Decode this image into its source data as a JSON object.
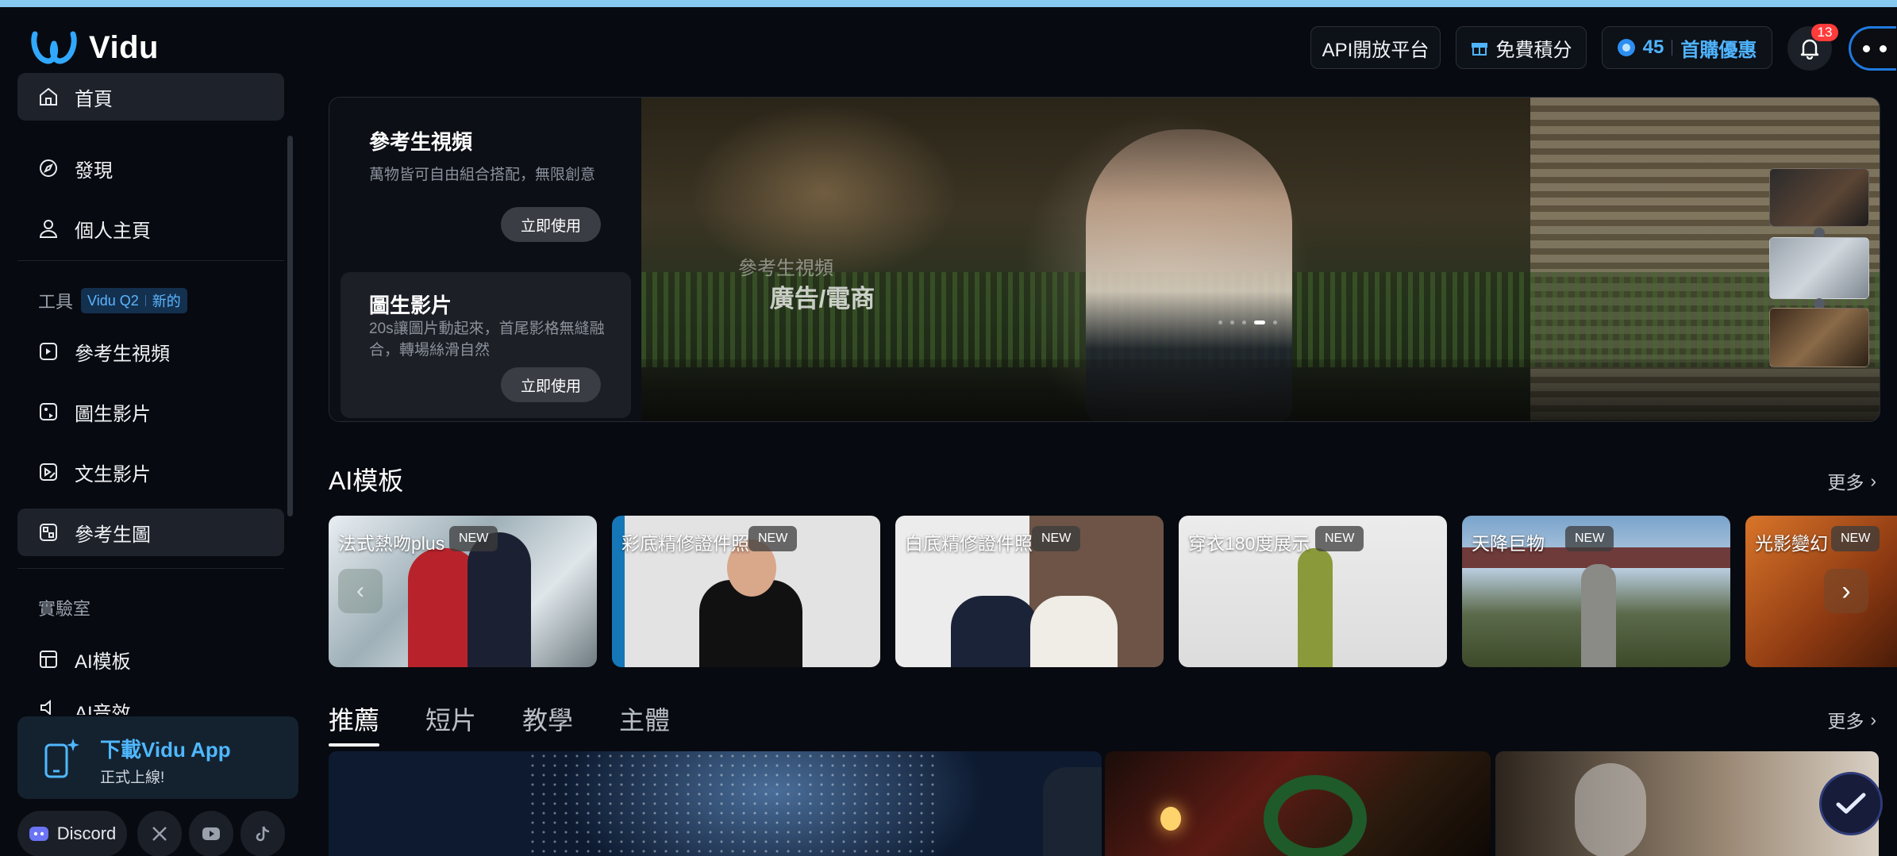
{
  "header": {
    "logo_text": "Vidu",
    "api_label": "API開放平台",
    "free_credits_label": "免費積分",
    "credits_count": "45",
    "buy_label": "首購優惠",
    "notification_count": "13"
  },
  "sidebar": {
    "nav": [
      {
        "label": "首頁",
        "icon": "home-icon"
      },
      {
        "label": "發現",
        "icon": "compass-icon"
      },
      {
        "label": "個人主頁",
        "icon": "user-icon"
      }
    ],
    "tools_section": {
      "label": "工具",
      "tag_model": "Vidu Q2",
      "tag_new": "新的"
    },
    "tools": [
      {
        "label": "參考生視頻",
        "icon": "reference-video-icon"
      },
      {
        "label": "圖生影片",
        "icon": "image-to-video-icon"
      },
      {
        "label": "文生影片",
        "icon": "text-to-video-icon"
      },
      {
        "label": "參考生圖",
        "icon": "reference-image-icon"
      }
    ],
    "lab_section": {
      "label": "實驗室"
    },
    "lab": [
      {
        "label": "AI模板",
        "icon": "template-icon"
      },
      {
        "label": "AI音效",
        "icon": "audio-icon"
      }
    ],
    "download": {
      "title": "下載Vidu App",
      "subtitle": "正式上線!"
    },
    "social": {
      "discord_label": "Discord"
    }
  },
  "hero": {
    "card1": {
      "title": "參考生視頻",
      "desc": "萬物皆可自由組合搭配，無限創意",
      "button": "立即使用"
    },
    "card2": {
      "title": "圖生影片",
      "desc": "20s讓圖片動起來，首尾影格無縫融合，轉場絲滑自然",
      "button": "立即使用"
    },
    "caption_small": "參考生視頻",
    "caption": "廣告/電商"
  },
  "templates": {
    "title": "AI模板",
    "more": "更多",
    "items": [
      {
        "label": "法式熱吻plus",
        "badge": "NEW"
      },
      {
        "label": "彩底精修證件照",
        "badge": "NEW"
      },
      {
        "label": "白底精修證件照",
        "badge": "NEW"
      },
      {
        "label": "穿衣180度展示",
        "badge": "NEW"
      },
      {
        "label": "天降巨物",
        "badge": "NEW"
      },
      {
        "label": "光影變幻",
        "badge": "NEW"
      }
    ]
  },
  "feed": {
    "tabs": [
      "推薦",
      "短片",
      "教學",
      "主體"
    ],
    "active_tab": "推薦",
    "more": "更多"
  },
  "colors": {
    "accent": "#4fb4ff",
    "background": "#070a10",
    "badge": "#ff3b3b"
  }
}
